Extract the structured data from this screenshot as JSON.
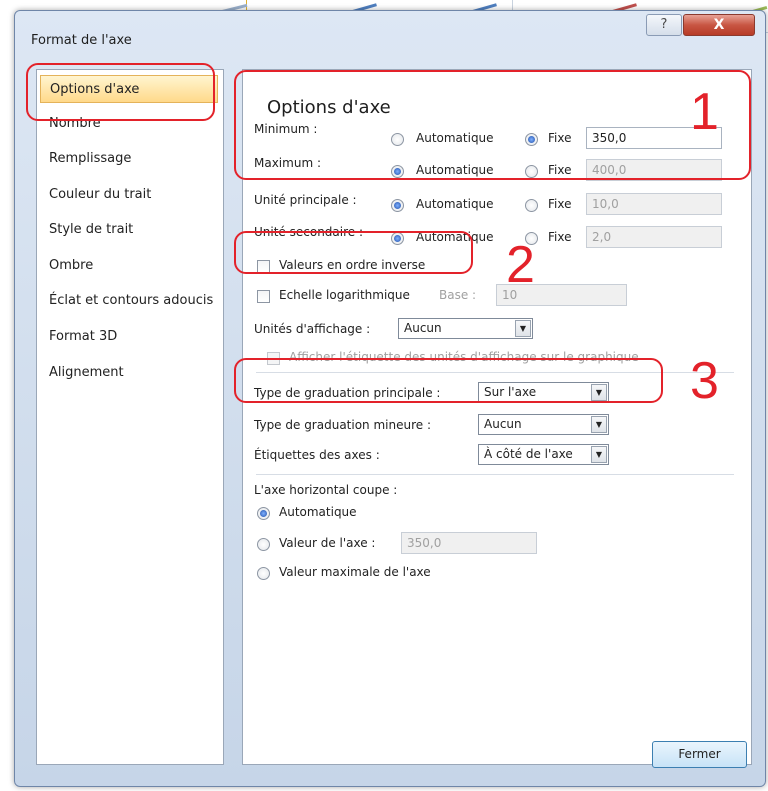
{
  "dialog": {
    "title": "Format de l'axe",
    "help_glyph": "?",
    "close_glyph": "X",
    "close_button_label": "Fermer"
  },
  "nav": {
    "items": [
      {
        "label": "Options d'axe",
        "selected": true
      },
      {
        "label": "Nombre"
      },
      {
        "label": "Remplissage"
      },
      {
        "label": "Couleur du trait"
      },
      {
        "label": "Style de trait"
      },
      {
        "label": "Ombre"
      },
      {
        "label": "Éclat et contours adoucis"
      },
      {
        "label": "Format 3D"
      },
      {
        "label": "Alignement"
      }
    ]
  },
  "panel": {
    "heading": "Options d'axe",
    "auto_label": "Automatique",
    "fixed_label": "Fixe",
    "rows": {
      "minimum": {
        "label": "Minimum :",
        "mode": "Fixe",
        "value": "350,0"
      },
      "maximum": {
        "label": "Maximum :",
        "mode": "Automatique",
        "value": "400,0"
      },
      "major_unit": {
        "label": "Unité principale :",
        "mode": "Automatique",
        "value": "10,0"
      },
      "minor_unit": {
        "label": "Unité secondaire :",
        "mode": "Automatique",
        "value": "2,0"
      }
    },
    "reverse_order": {
      "label": "Valeurs en ordre inverse",
      "checked": false
    },
    "log_scale": {
      "label": "Echelle logarithmique",
      "base_label": "Base :",
      "base_value": "10",
      "checked": false
    },
    "display_units": {
      "label": "Unités d'affichage :",
      "value": "Aucun"
    },
    "show_units_label": {
      "label": "Afficher l'étiquette des unités d'affichage sur le graphique",
      "checked": false,
      "disabled": true
    },
    "major_tick": {
      "label": "Type de graduation principale :",
      "value": "Sur l'axe"
    },
    "minor_tick": {
      "label": "Type de graduation mineure :",
      "value": "Aucun"
    },
    "axis_labels": {
      "label": "Étiquettes des axes :",
      "value": "À côté de l'axe"
    },
    "crosses": {
      "label": "L'axe horizontal coupe :",
      "options": [
        "Automatique",
        "Valeur de l'axe :",
        "Valeur maximale de l'axe"
      ],
      "selected": "Automatique",
      "axis_value": "350,0"
    }
  },
  "annotations": {
    "one": "1",
    "two": "2",
    "three": "3",
    "color": "#e3222a"
  },
  "colors": {
    "selection_bg": "#ffd98a",
    "radio_selected": "#1f4fa8"
  }
}
